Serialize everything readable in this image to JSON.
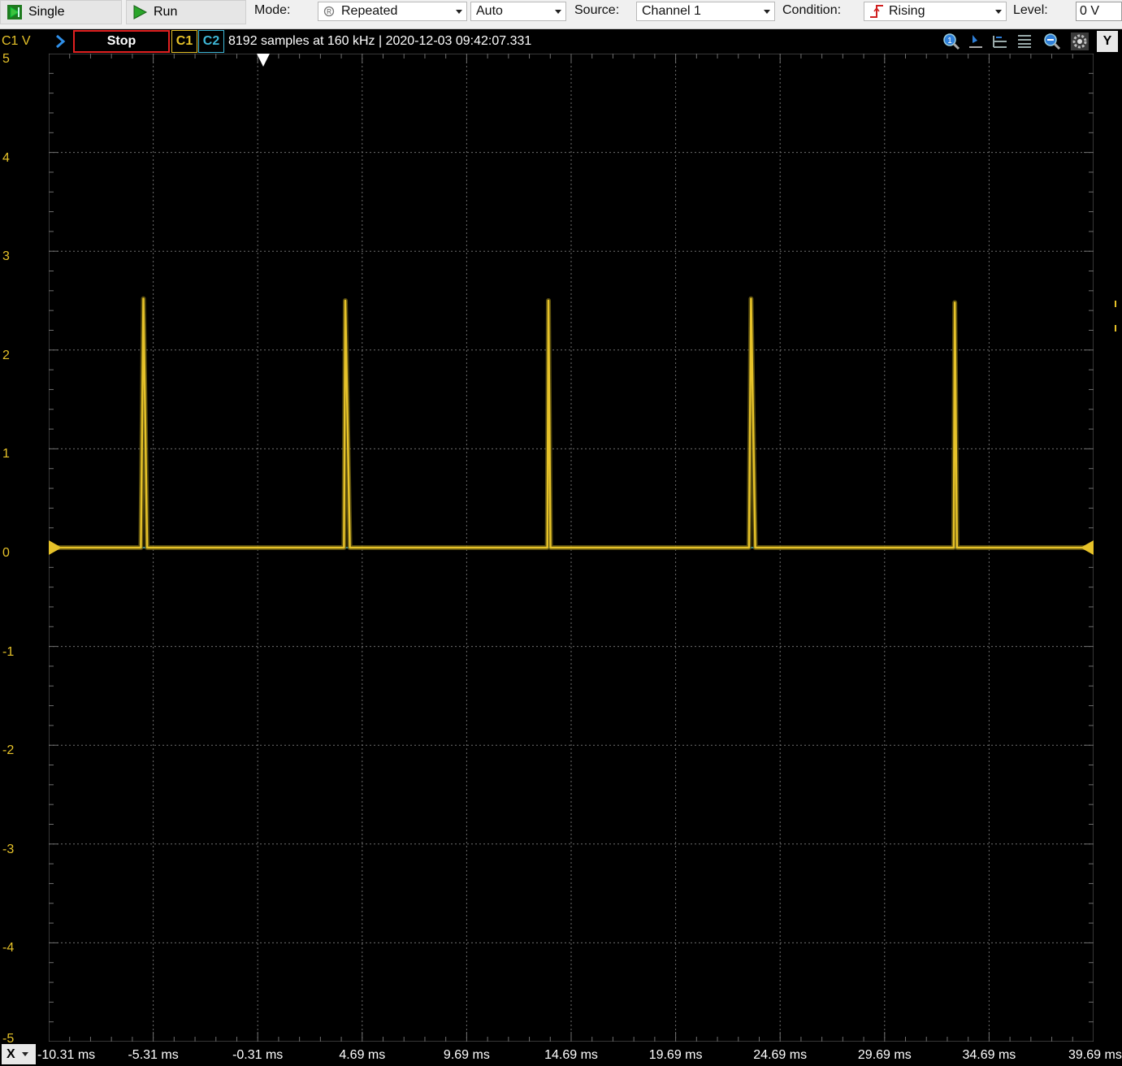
{
  "toolbar": {
    "single_label": "Single",
    "run_label": "Run",
    "mode_label": "Mode:",
    "mode_value": "Repeated",
    "auto_value": "Auto",
    "source_label": "Source:",
    "source_value": "Channel 1",
    "condition_label": "Condition:",
    "condition_value": "Rising",
    "level_label": "Level:",
    "level_value": "0 V"
  },
  "status": {
    "axis_name": "C1 V",
    "stop_label": "Stop",
    "c1_label": "C1",
    "c2_label": "C2",
    "info": "8192 samples at 160 kHz | 2020-12-03 09:42:07.331",
    "y_button": "Y"
  },
  "xaxis": {
    "x_button": "X"
  },
  "colors": {
    "c1": "#e6c229",
    "c2": "#3fb8d8",
    "stop_border": "#e02020",
    "grid": "#6e6e6e"
  },
  "icons": [
    "play-single-icon",
    "play-run-icon",
    "repeat-icon",
    "rising-edge-icon",
    "zoom-1-icon",
    "cursor-icon",
    "align-left-icon",
    "align-right-icon",
    "zoom-icon",
    "settings-icon",
    "chevron-right-icon",
    "trigger-marker-icon"
  ],
  "chart_data": {
    "type": "line",
    "xlabel": "",
    "ylabel": "C1 V",
    "xlim": [
      -10.31,
      39.69
    ],
    "ylim": [
      -5,
      5
    ],
    "x_ticks": [
      "-10.31 ms",
      "-5.31 ms",
      "-0.31 ms",
      "4.69 ms",
      "9.69 ms",
      "14.69 ms",
      "19.69 ms",
      "24.69 ms",
      "29.69 ms",
      "34.69 ms",
      "39.69 ms"
    ],
    "y_ticks": [
      "5",
      "4",
      "3",
      "2",
      "1",
      "0",
      "-1",
      "-2",
      "-3",
      "-4",
      "-5"
    ],
    "grid": true,
    "series": [
      {
        "name": "C1",
        "x": [
          -10.31,
          -5.9,
          -5.78,
          -5.6,
          3.82,
          3.88,
          4.1,
          13.55,
          13.6,
          13.7,
          23.2,
          23.3,
          23.5,
          33.0,
          33.05,
          33.15,
          39.69
        ],
        "y": [
          0,
          0,
          2.52,
          0,
          0,
          2.5,
          0,
          0,
          2.5,
          0,
          0,
          2.52,
          0,
          0,
          2.48,
          0,
          0
        ]
      },
      {
        "name": "C2",
        "x": [
          -10.31,
          39.69
        ],
        "y": [
          0,
          0
        ]
      }
    ]
  }
}
